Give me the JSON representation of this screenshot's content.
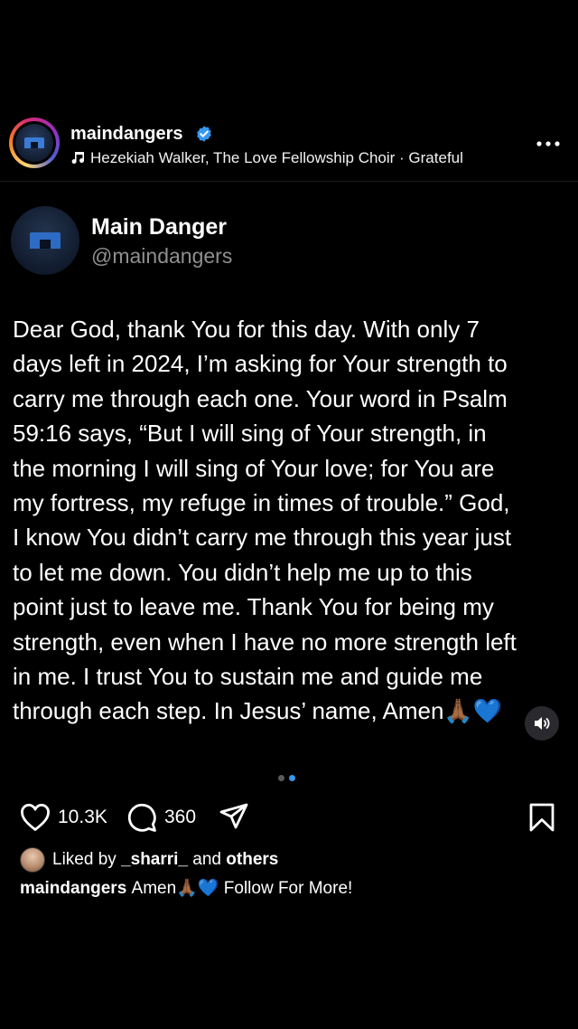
{
  "post": {
    "username": "maindangers",
    "verified": true,
    "music": "Hezekiah Walker, The Love Fellowship Choir · Grateful",
    "more_icon": "more-horizontal-icon"
  },
  "tweet": {
    "display_name": "Main Danger",
    "handle": "@maindangers",
    "lines": [
      "Dear God, thank You for this day. With only 7",
      "days left in 2024, I’m asking for Your strength to",
      "carry me through each one. Your word in Psalm",
      "59:16 says, “But I will sing of Your strength, in",
      "the morning I will sing of Your love; for You are",
      "my fortress, my refuge in times of trouble.” God,",
      "I know You didn’t carry me through this year just",
      "to let me down. You didn’t help me up to this",
      "point just to leave me. Thank You for being my",
      "strength, even when I have no more strength left",
      "in me. I trust You to sustain me and guide me",
      "through each step. In Jesus’ name, Amen🙏🏾💙"
    ]
  },
  "carousel": {
    "total": 2,
    "current": 2,
    "active_color": "#3797f0",
    "inactive_color": "#5a5a5a"
  },
  "actions": {
    "likes": "10.3K",
    "comments": "360",
    "like_icon": "heart-icon",
    "comment_icon": "comment-icon",
    "share_icon": "send-icon",
    "save_icon": "bookmark-icon",
    "sound_icon": "speaker-icon"
  },
  "liked_by": {
    "prefix": "Liked by",
    "user": "_sharri_",
    "middle": "and",
    "others": "others"
  },
  "caption": {
    "username": "maindangers",
    "text": "Amen🙏🏾💙 Follow For More!"
  },
  "colors": {
    "background": "#000000",
    "verified": "#3797f0",
    "handle": "#8f8f8f"
  }
}
